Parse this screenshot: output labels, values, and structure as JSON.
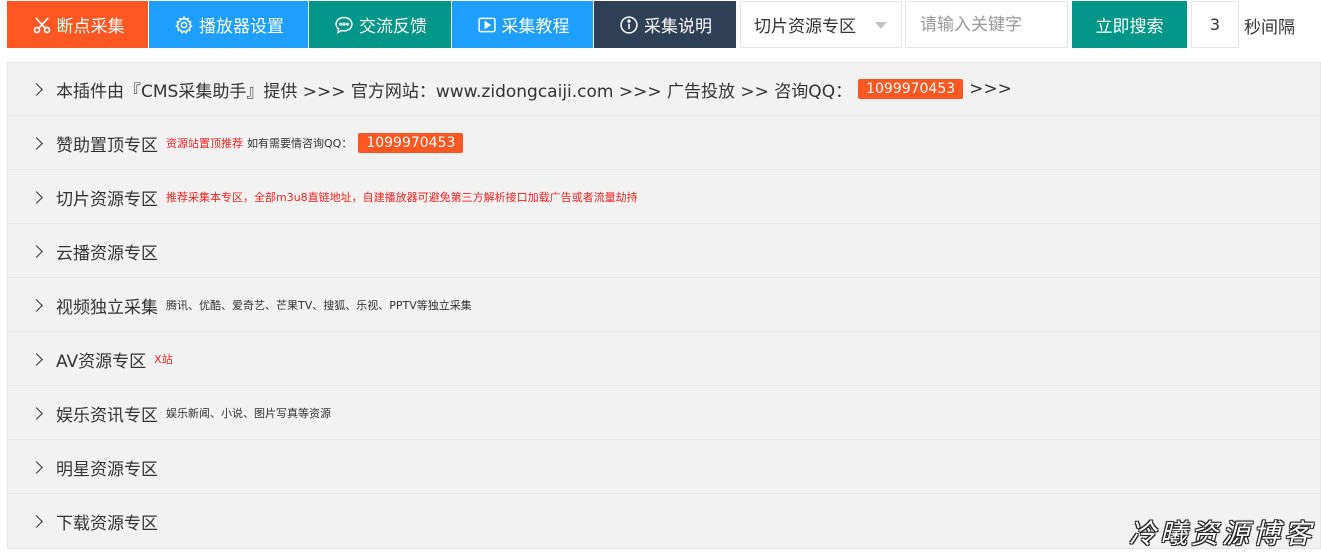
{
  "toolbar": {
    "resume": "断点采集",
    "player": "播放器设置",
    "feedback": "交流反馈",
    "tutorial": "采集教程",
    "help": "采集说明",
    "category_select": "切片资源专区",
    "search_placeholder": "请输入关键字",
    "search_button": "立即搜索",
    "interval_value": "3",
    "interval_label": "秒间隔"
  },
  "rows": [
    {
      "title": "本插件由『CMS采集助手』提供 >>> 官方网站：www.zidongcaiji.com >>> 广告投放 >> 咨询QQ：",
      "badge": "1099970453",
      "after": ">>>"
    },
    {
      "title": "赞助置顶专区",
      "note_red": "资源站置顶推荐",
      "note_dark": "如有需要情咨询QQ：",
      "badge": "1099970453"
    },
    {
      "title": "切片资源专区",
      "note_red": "推荐采集本专区，全部m3u8直链地址，自建播放器可避免第三方解析接口加载广告或者流量劫持"
    },
    {
      "title": "云播资源专区"
    },
    {
      "title": "视频独立采集",
      "note_dark": "腾讯、优酷、爱奇艺、芒果TV、搜狐、乐视、PPTV等独立采集"
    },
    {
      "title": "AV资源专区",
      "note_red": "X站"
    },
    {
      "title": "娱乐资讯专区",
      "note_dark": "娱乐新闻、小说、图片写真等资源"
    },
    {
      "title": "明星资源专区"
    },
    {
      "title": "下载资源专区"
    }
  ],
  "watermark": "冷曦资源博客",
  "colors": {
    "orange": "#ff5722",
    "blue": "#1e9fff",
    "green": "#009688",
    "dark": "#2f4056"
  },
  "icons": {
    "resume": "scissors-icon",
    "player": "gear-icon",
    "feedback": "chat-icon",
    "tutorial": "video-icon",
    "help": "info-icon"
  }
}
